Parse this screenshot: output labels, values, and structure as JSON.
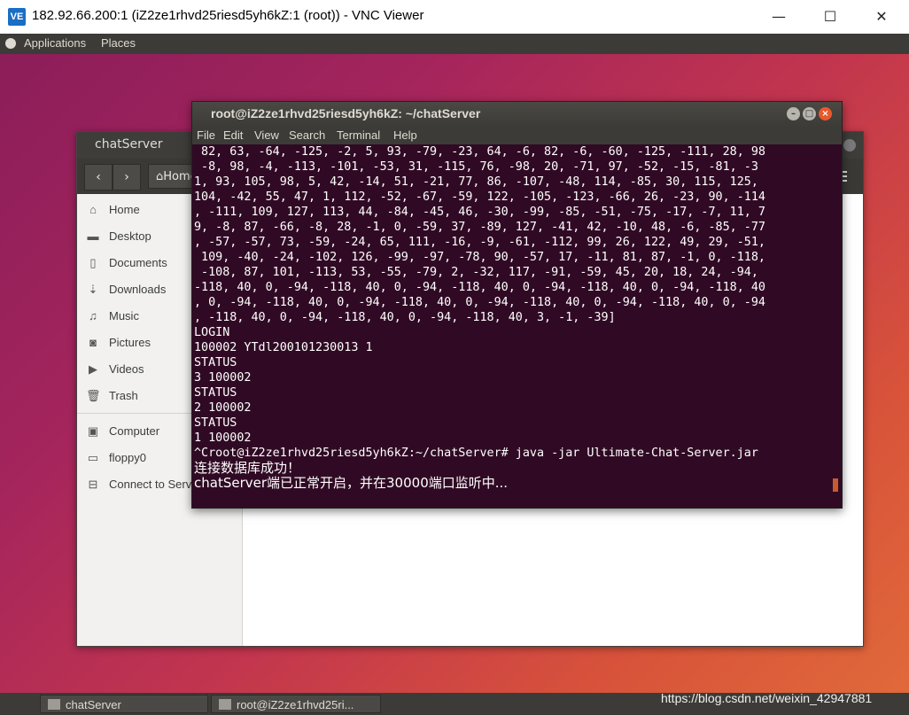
{
  "vnc": {
    "logo": "VE",
    "title": "182.92.66.200:1 (iZ2ze1rhvd25riesd5yh6kZ:1 (root)) - VNC Viewer",
    "minimize": "—",
    "maximize": "☐",
    "close": "✕"
  },
  "panel": {
    "applications": "Applications",
    "places": "Places"
  },
  "nautilus": {
    "title": "chatServer",
    "back": "‹",
    "forward": "›",
    "crumb": "Home",
    "sidebar": [
      {
        "icon": "⌂",
        "label": "Home"
      },
      {
        "icon": "▬",
        "label": "Desktop"
      },
      {
        "icon": "▯",
        "label": "Documents"
      },
      {
        "icon": "⇣",
        "label": "Downloads"
      },
      {
        "icon": "♫",
        "label": "Music"
      },
      {
        "icon": "◙",
        "label": "Pictures"
      },
      {
        "icon": "▶",
        "label": "Videos"
      },
      {
        "icon": "🗑",
        "label": "Trash"
      },
      {
        "icon": "▣",
        "label": "Computer"
      },
      {
        "icon": "▭",
        "label": "floppy0"
      },
      {
        "icon": "⊟",
        "label": "Connect to Server"
      }
    ]
  },
  "terminal": {
    "title": "root@iZ2ze1rhvd25riesd5yh6kZ: ~/chatServer",
    "menu": [
      "File",
      "Edit",
      "View",
      "Search",
      "Terminal",
      "Help"
    ],
    "lines": [
      " 82, 63, -64, -125, -2, 5, 93, -79, -23, 64, -6, 82, -6, -60, -125, -111, 28, 98",
      " -8, 98, -4, -113, -101, -53, 31, -115, 76, -98, 20, -71, 97, -52, -15, -81, -3",
      "1, 93, 105, 98, 5, 42, -14, 51, -21, 77, 86, -107, -48, 114, -85, 30, 115, 125,",
      "104, -42, 55, 47, 1, 112, -52, -67, -59, 122, -105, -123, -66, 26, -23, 90, -114",
      ", -111, 109, 127, 113, 44, -84, -45, 46, -30, -99, -85, -51, -75, -17, -7, 11, 7",
      "9, -8, 87, -66, -8, 28, -1, 0, -59, 37, -89, 127, -41, 42, -10, 48, -6, -85, -77",
      ", -57, -57, 73, -59, -24, 65, 111, -16, -9, -61, -112, 99, 26, 122, 49, 29, -51,",
      " 109, -40, -24, -102, 126, -99, -97, -78, 90, -57, 17, -11, 81, 87, -1, 0, -118,",
      " -108, 87, 101, -113, 53, -55, -79, 2, -32, 117, -91, -59, 45, 20, 18, 24, -94,",
      "-118, 40, 0, -94, -118, 40, 0, -94, -118, 40, 0, -94, -118, 40, 0, -94, -118, 40",
      ", 0, -94, -118, 40, 0, -94, -118, 40, 0, -94, -118, 40, 0, -94, -118, 40, 0, -94",
      ", -118, 40, 0, -94, -118, 40, 0, -94, -118, 40, 3, -1, -39]",
      "LOGIN",
      "100002 YTdl200101230013 1",
      "STATUS",
      "3 100002",
      "STATUS",
      "2 100002",
      "STATUS",
      "1 100002",
      "^Croot@iZ2ze1rhvd25riesd5yh6kZ:~/chatServer# java -jar Ultimate-Chat-Server.jar"
    ],
    "cn_line1": "连接数据库成功！",
    "cn_line2": "chatServer端已正常开启，并在30000端口监听中..."
  },
  "taskbar": {
    "task1": "chatServer",
    "task2": "root@iZ2ze1rhvd25ri..."
  },
  "watermark": "https://blog.csdn.net/weixin_42947881"
}
